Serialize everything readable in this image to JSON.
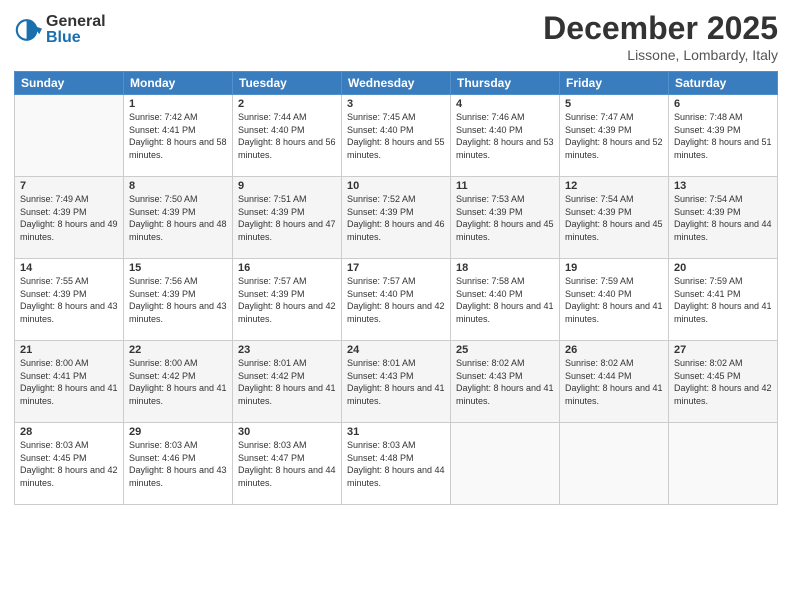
{
  "header": {
    "logo_general": "General",
    "logo_blue": "Blue",
    "month": "December 2025",
    "location": "Lissone, Lombardy, Italy"
  },
  "weekdays": [
    "Sunday",
    "Monday",
    "Tuesday",
    "Wednesday",
    "Thursday",
    "Friday",
    "Saturday"
  ],
  "weeks": [
    [
      {
        "day": null,
        "info": null
      },
      {
        "day": "1",
        "sunrise": "7:42 AM",
        "sunset": "4:41 PM",
        "daylight": "8 hours and 58 minutes."
      },
      {
        "day": "2",
        "sunrise": "7:44 AM",
        "sunset": "4:40 PM",
        "daylight": "8 hours and 56 minutes."
      },
      {
        "day": "3",
        "sunrise": "7:45 AM",
        "sunset": "4:40 PM",
        "daylight": "8 hours and 55 minutes."
      },
      {
        "day": "4",
        "sunrise": "7:46 AM",
        "sunset": "4:40 PM",
        "daylight": "8 hours and 53 minutes."
      },
      {
        "day": "5",
        "sunrise": "7:47 AM",
        "sunset": "4:39 PM",
        "daylight": "8 hours and 52 minutes."
      },
      {
        "day": "6",
        "sunrise": "7:48 AM",
        "sunset": "4:39 PM",
        "daylight": "8 hours and 51 minutes."
      }
    ],
    [
      {
        "day": "7",
        "sunrise": "7:49 AM",
        "sunset": "4:39 PM",
        "daylight": "8 hours and 49 minutes."
      },
      {
        "day": "8",
        "sunrise": "7:50 AM",
        "sunset": "4:39 PM",
        "daylight": "8 hours and 48 minutes."
      },
      {
        "day": "9",
        "sunrise": "7:51 AM",
        "sunset": "4:39 PM",
        "daylight": "8 hours and 47 minutes."
      },
      {
        "day": "10",
        "sunrise": "7:52 AM",
        "sunset": "4:39 PM",
        "daylight": "8 hours and 46 minutes."
      },
      {
        "day": "11",
        "sunrise": "7:53 AM",
        "sunset": "4:39 PM",
        "daylight": "8 hours and 45 minutes."
      },
      {
        "day": "12",
        "sunrise": "7:54 AM",
        "sunset": "4:39 PM",
        "daylight": "8 hours and 45 minutes."
      },
      {
        "day": "13",
        "sunrise": "7:54 AM",
        "sunset": "4:39 PM",
        "daylight": "8 hours and 44 minutes."
      }
    ],
    [
      {
        "day": "14",
        "sunrise": "7:55 AM",
        "sunset": "4:39 PM",
        "daylight": "8 hours and 43 minutes."
      },
      {
        "day": "15",
        "sunrise": "7:56 AM",
        "sunset": "4:39 PM",
        "daylight": "8 hours and 43 minutes."
      },
      {
        "day": "16",
        "sunrise": "7:57 AM",
        "sunset": "4:39 PM",
        "daylight": "8 hours and 42 minutes."
      },
      {
        "day": "17",
        "sunrise": "7:57 AM",
        "sunset": "4:40 PM",
        "daylight": "8 hours and 42 minutes."
      },
      {
        "day": "18",
        "sunrise": "7:58 AM",
        "sunset": "4:40 PM",
        "daylight": "8 hours and 41 minutes."
      },
      {
        "day": "19",
        "sunrise": "7:59 AM",
        "sunset": "4:40 PM",
        "daylight": "8 hours and 41 minutes."
      },
      {
        "day": "20",
        "sunrise": "7:59 AM",
        "sunset": "4:41 PM",
        "daylight": "8 hours and 41 minutes."
      }
    ],
    [
      {
        "day": "21",
        "sunrise": "8:00 AM",
        "sunset": "4:41 PM",
        "daylight": "8 hours and 41 minutes."
      },
      {
        "day": "22",
        "sunrise": "8:00 AM",
        "sunset": "4:42 PM",
        "daylight": "8 hours and 41 minutes."
      },
      {
        "day": "23",
        "sunrise": "8:01 AM",
        "sunset": "4:42 PM",
        "daylight": "8 hours and 41 minutes."
      },
      {
        "day": "24",
        "sunrise": "8:01 AM",
        "sunset": "4:43 PM",
        "daylight": "8 hours and 41 minutes."
      },
      {
        "day": "25",
        "sunrise": "8:02 AM",
        "sunset": "4:43 PM",
        "daylight": "8 hours and 41 minutes."
      },
      {
        "day": "26",
        "sunrise": "8:02 AM",
        "sunset": "4:44 PM",
        "daylight": "8 hours and 41 minutes."
      },
      {
        "day": "27",
        "sunrise": "8:02 AM",
        "sunset": "4:45 PM",
        "daylight": "8 hours and 42 minutes."
      }
    ],
    [
      {
        "day": "28",
        "sunrise": "8:03 AM",
        "sunset": "4:45 PM",
        "daylight": "8 hours and 42 minutes."
      },
      {
        "day": "29",
        "sunrise": "8:03 AM",
        "sunset": "4:46 PM",
        "daylight": "8 hours and 43 minutes."
      },
      {
        "day": "30",
        "sunrise": "8:03 AM",
        "sunset": "4:47 PM",
        "daylight": "8 hours and 44 minutes."
      },
      {
        "day": "31",
        "sunrise": "8:03 AM",
        "sunset": "4:48 PM",
        "daylight": "8 hours and 44 minutes."
      },
      {
        "day": null,
        "info": null
      },
      {
        "day": null,
        "info": null
      },
      {
        "day": null,
        "info": null
      }
    ]
  ]
}
